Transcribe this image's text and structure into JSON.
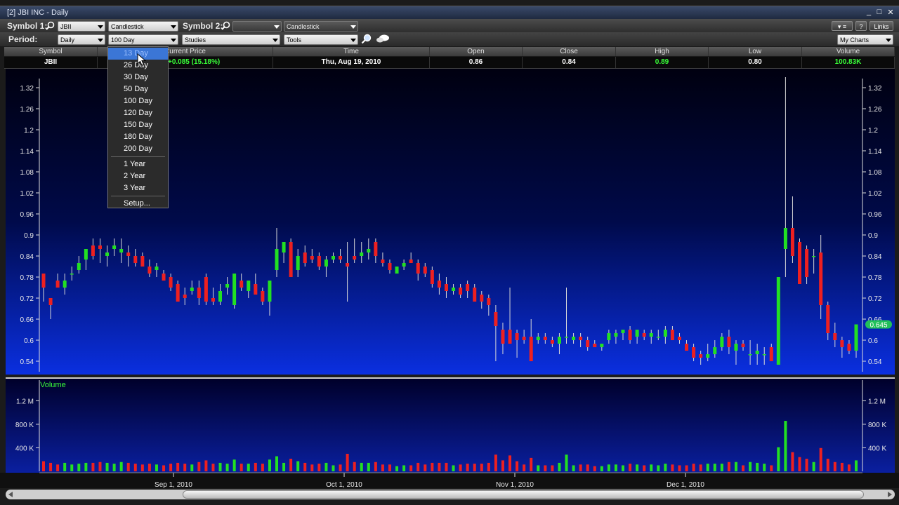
{
  "window": {
    "title": "[2] JBI INC - Daily",
    "controls": [
      "_",
      "□",
      "✕"
    ]
  },
  "toolbar": {
    "symbol1_label": "Symbol 1:",
    "symbol1_value": "JBII",
    "chart_style1": "Candlestick",
    "symbol2_label": "Symbol 2:",
    "symbol2_value": "",
    "chart_style2": "Candlestick",
    "period_label": "Period:",
    "period_value": "Daily",
    "range_value": "100 Day",
    "studies": "Studies",
    "tools": "Tools",
    "help": "?",
    "links": "Links",
    "my_charts": "My Charts"
  },
  "quote": {
    "headers": [
      "Symbol",
      "Current Price",
      "Time",
      "Open",
      "Close",
      "High",
      "Low",
      "Volume"
    ],
    "values": [
      "JBII",
      "+0.085 (15.18%)",
      "Thu, Aug 19, 2010",
      "0.86",
      "0.84",
      "0.89",
      "0.80",
      "100.83K"
    ],
    "colors": [
      "#ffffff",
      "#39ff39",
      "#ffffff",
      "#ffffff",
      "#ffffff",
      "#39ff39",
      "#ffffff",
      "#39ff39"
    ]
  },
  "period_dropdown": {
    "items": [
      "13 Day",
      "26 Day",
      "30 Day",
      "50 Day",
      "100 Day",
      "120 Day",
      "150 Day",
      "180 Day",
      "200 Day",
      "1 Year",
      "2 Year",
      "3 Year",
      "Setup..."
    ],
    "selected": "13 Day"
  },
  "colors": {
    "up": "#22e022",
    "down": "#ee2020"
  },
  "chart_data": [
    {
      "type": "candlestick",
      "y_ticks": [
        "1.32",
        "1.26",
        "1.2",
        "1.14",
        "1.08",
        "1.02",
        "0.96",
        "0.9",
        "0.84",
        "0.78",
        "0.72",
        "0.66",
        "0.6",
        "0.54"
      ],
      "ylim": [
        0.51,
        1.35
      ],
      "last_price_label": "0.645",
      "x_ticks": [
        "Sep 1, 2010",
        "Oct 1, 2010",
        "Nov 1, 2010",
        "Dec 1, 2010"
      ],
      "ohlc": [
        [
          0.79,
          0.79,
          0.71,
          0.75
        ],
        [
          0.72,
          0.72,
          0.66,
          0.7
        ],
        [
          0.77,
          0.79,
          0.75,
          0.75
        ],
        [
          0.75,
          0.79,
          0.73,
          0.77
        ],
        [
          0.79,
          0.81,
          0.77,
          0.79
        ],
        [
          0.8,
          0.84,
          0.79,
          0.82
        ],
        [
          0.83,
          0.86,
          0.8,
          0.86
        ],
        [
          0.87,
          0.89,
          0.83,
          0.84
        ],
        [
          0.87,
          0.89,
          0.82,
          0.86
        ],
        [
          0.84,
          0.87,
          0.81,
          0.85
        ],
        [
          0.86,
          0.89,
          0.84,
          0.87
        ],
        [
          0.85,
          0.89,
          0.82,
          0.86
        ],
        [
          0.85,
          0.87,
          0.81,
          0.84
        ],
        [
          0.84,
          0.86,
          0.81,
          0.82
        ],
        [
          0.84,
          0.85,
          0.81,
          0.81
        ],
        [
          0.81,
          0.83,
          0.78,
          0.79
        ],
        [
          0.8,
          0.82,
          0.78,
          0.81
        ],
        [
          0.79,
          0.8,
          0.77,
          0.77
        ],
        [
          0.78,
          0.79,
          0.74,
          0.75
        ],
        [
          0.76,
          0.77,
          0.71,
          0.71
        ],
        [
          0.73,
          0.75,
          0.7,
          0.72
        ],
        [
          0.74,
          0.77,
          0.73,
          0.75
        ],
        [
          0.75,
          0.77,
          0.7,
          0.72
        ],
        [
          0.78,
          0.79,
          0.7,
          0.71
        ],
        [
          0.72,
          0.75,
          0.7,
          0.71
        ],
        [
          0.71,
          0.76,
          0.7,
          0.74
        ],
        [
          0.75,
          0.78,
          0.73,
          0.76
        ],
        [
          0.7,
          0.79,
          0.69,
          0.79
        ],
        [
          0.77,
          0.79,
          0.74,
          0.75
        ],
        [
          0.74,
          0.77,
          0.72,
          0.77
        ],
        [
          0.76,
          0.79,
          0.73,
          0.73
        ],
        [
          0.74,
          0.75,
          0.7,
          0.71
        ],
        [
          0.71,
          0.77,
          0.67,
          0.77
        ],
        [
          0.8,
          0.92,
          0.78,
          0.86
        ],
        [
          0.85,
          0.88,
          0.82,
          0.88
        ],
        [
          0.88,
          0.89,
          0.78,
          0.78
        ],
        [
          0.8,
          0.86,
          0.78,
          0.84
        ],
        [
          0.85,
          0.87,
          0.81,
          0.82
        ],
        [
          0.84,
          0.86,
          0.82,
          0.83
        ],
        [
          0.84,
          0.85,
          0.8,
          0.81
        ],
        [
          0.81,
          0.84,
          0.78,
          0.83
        ],
        [
          0.83,
          0.85,
          0.82,
          0.84
        ],
        [
          0.84,
          0.86,
          0.82,
          0.83
        ],
        [
          0.82,
          0.88,
          0.71,
          0.81
        ],
        [
          0.84,
          0.89,
          0.82,
          0.83
        ],
        [
          0.84,
          0.88,
          0.82,
          0.85
        ],
        [
          0.85,
          0.89,
          0.83,
          0.86
        ],
        [
          0.88,
          0.89,
          0.82,
          0.84
        ],
        [
          0.83,
          0.85,
          0.81,
          0.82
        ],
        [
          0.82,
          0.83,
          0.79,
          0.8
        ],
        [
          0.79,
          0.81,
          0.79,
          0.81
        ],
        [
          0.81,
          0.83,
          0.8,
          0.82
        ],
        [
          0.83,
          0.85,
          0.82,
          0.82
        ],
        [
          0.82,
          0.83,
          0.77,
          0.79
        ],
        [
          0.81,
          0.82,
          0.78,
          0.79
        ],
        [
          0.8,
          0.81,
          0.75,
          0.76
        ],
        [
          0.77,
          0.79,
          0.73,
          0.75
        ],
        [
          0.76,
          0.78,
          0.72,
          0.74
        ],
        [
          0.74,
          0.76,
          0.73,
          0.75
        ],
        [
          0.75,
          0.76,
          0.72,
          0.73
        ],
        [
          0.76,
          0.77,
          0.72,
          0.74
        ],
        [
          0.75,
          0.76,
          0.71,
          0.71
        ],
        [
          0.73,
          0.74,
          0.69,
          0.71
        ],
        [
          0.72,
          0.73,
          0.67,
          0.7
        ],
        [
          0.68,
          0.7,
          0.54,
          0.64
        ],
        [
          0.63,
          0.65,
          0.56,
          0.59
        ],
        [
          0.63,
          0.75,
          0.6,
          0.59
        ],
        [
          0.62,
          0.63,
          0.55,
          0.6
        ],
        [
          0.61,
          0.63,
          0.59,
          0.6
        ],
        [
          0.61,
          0.66,
          0.54,
          0.54
        ],
        [
          0.6,
          0.62,
          0.59,
          0.61
        ],
        [
          0.61,
          0.62,
          0.59,
          0.6
        ],
        [
          0.6,
          0.61,
          0.58,
          0.59
        ],
        [
          0.59,
          0.62,
          0.56,
          0.61
        ],
        [
          0.61,
          0.75,
          0.59,
          0.61
        ],
        [
          0.6,
          0.62,
          0.59,
          0.61
        ],
        [
          0.61,
          0.62,
          0.58,
          0.6
        ],
        [
          0.6,
          0.61,
          0.57,
          0.58
        ],
        [
          0.59,
          0.6,
          0.58,
          0.58
        ],
        [
          0.58,
          0.59,
          0.57,
          0.59
        ],
        [
          0.6,
          0.63,
          0.59,
          0.62
        ],
        [
          0.61,
          0.63,
          0.59,
          0.62
        ],
        [
          0.62,
          0.63,
          0.6,
          0.63
        ],
        [
          0.63,
          0.64,
          0.59,
          0.6
        ],
        [
          0.61,
          0.63,
          0.59,
          0.63
        ],
        [
          0.62,
          0.63,
          0.6,
          0.61
        ],
        [
          0.61,
          0.63,
          0.59,
          0.62
        ],
        [
          0.61,
          0.63,
          0.6,
          0.61
        ],
        [
          0.61,
          0.64,
          0.59,
          0.63
        ],
        [
          0.63,
          0.64,
          0.6,
          0.6
        ],
        [
          0.61,
          0.62,
          0.59,
          0.6
        ],
        [
          0.59,
          0.6,
          0.57,
          0.57
        ],
        [
          0.58,
          0.59,
          0.54,
          0.55
        ],
        [
          0.56,
          0.57,
          0.53,
          0.55
        ],
        [
          0.55,
          0.59,
          0.54,
          0.56
        ],
        [
          0.56,
          0.6,
          0.55,
          0.58
        ],
        [
          0.58,
          0.62,
          0.57,
          0.61
        ],
        [
          0.61,
          0.63,
          0.56,
          0.58
        ],
        [
          0.57,
          0.6,
          0.53,
          0.59
        ],
        [
          0.59,
          0.6,
          0.57,
          0.58
        ],
        [
          0.56,
          0.6,
          0.53,
          0.56
        ],
        [
          0.56,
          0.59,
          0.53,
          0.57
        ],
        [
          0.56,
          0.58,
          0.53,
          0.56
        ],
        [
          0.58,
          0.59,
          0.56,
          0.54
        ]
      ],
      "ohlc_tail": [
        [
          0.53,
          0.78,
          0.53,
          0.78
        ],
        [
          0.86,
          1.35,
          0.78,
          0.92
        ],
        [
          0.92,
          1.01,
          0.82,
          0.84
        ],
        [
          0.88,
          0.89,
          0.76,
          0.76
        ],
        [
          0.86,
          0.87,
          0.76,
          0.78
        ],
        [
          0.84,
          0.86,
          0.79,
          0.84
        ],
        [
          0.85,
          0.9,
          0.66,
          0.7
        ],
        [
          0.7,
          0.71,
          0.6,
          0.62
        ],
        [
          0.62,
          0.65,
          0.58,
          0.6
        ],
        [
          0.6,
          0.61,
          0.55,
          0.58
        ],
        [
          0.59,
          0.6,
          0.56,
          0.57
        ],
        [
          0.57,
          0.64,
          0.55,
          0.645
        ]
      ]
    },
    {
      "type": "bar",
      "title": "Volume",
      "y_ticks": [
        "1.2 M",
        "800 K",
        "400 K"
      ],
      "ylim": [
        0,
        1550000
      ]
    }
  ]
}
